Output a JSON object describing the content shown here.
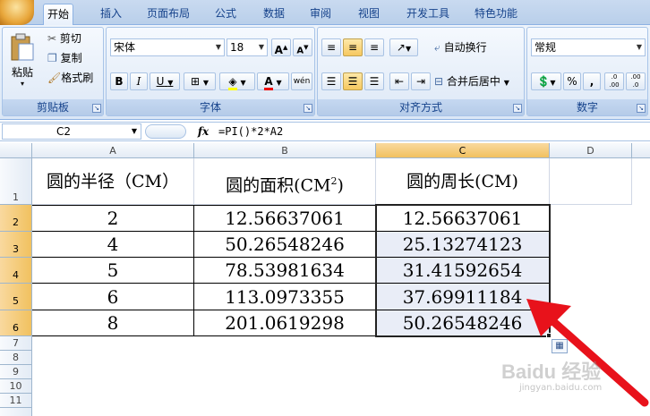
{
  "tabs": [
    "开始",
    "插入",
    "页面布局",
    "公式",
    "数据",
    "审阅",
    "视图",
    "开发工具",
    "特色功能"
  ],
  "clipboard": {
    "paste": "粘贴",
    "cut": "剪切",
    "copy": "复制",
    "format_painter": "格式刷",
    "label": "剪贴板"
  },
  "font": {
    "name": "宋体",
    "size": "18",
    "grow": "A",
    "shrink": "A",
    "bold": "B",
    "italic": "I",
    "underline": "U",
    "phonetic": "wén",
    "label": "字体"
  },
  "alignment": {
    "wrap": "自动换行",
    "merge": "合并后居中",
    "label": "对齐方式"
  },
  "number": {
    "format": "常规",
    "percent": "%",
    "comma": ",",
    "inc_decimal": ".0 .00",
    "dec_decimal": ".00 .0",
    "label": "数字"
  },
  "formula_bar": {
    "name_box": "C2",
    "fx": "fx",
    "formula": "=PI()*2*A2"
  },
  "columns": [
    "A",
    "B",
    "C",
    "D"
  ],
  "rows": [
    "1",
    "2",
    "3",
    "4",
    "5",
    "6",
    "7",
    "8",
    "9",
    "10",
    "11"
  ],
  "table": {
    "header": {
      "a": "圆的半径（CM）",
      "b": "圆的面积(CM",
      "b_sup": "2",
      "b_end": ")",
      "c": "圆的周长(CM)"
    },
    "data": [
      [
        "2",
        "12.56637061",
        "12.56637061"
      ],
      [
        "4",
        "50.26548246",
        "25.13274123"
      ],
      [
        "5",
        "78.53981634",
        "31.41592654"
      ],
      [
        "6",
        "113.0973355",
        "37.69911184"
      ],
      [
        "8",
        "201.0619298",
        "50.26548246"
      ]
    ]
  },
  "watermark": {
    "brand": "Baidu 经验",
    "url": "jingyan.baidu.com"
  },
  "colors": {
    "arrow": "#e8121b",
    "selection": "#e9edf7",
    "header_sel": "#f1c15f"
  }
}
